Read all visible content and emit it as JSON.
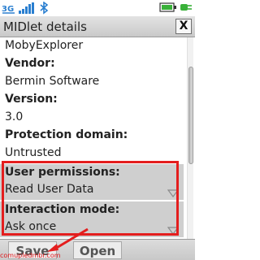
{
  "status_bar": {
    "icons": [
      "network-3g-icon",
      "signal-strength-icon",
      "bluetooth-icon",
      "battery-icon",
      "charging-plug-icon"
    ]
  },
  "window": {
    "title": "MIDlet details",
    "close_label": "X"
  },
  "details": {
    "name_value": "MobyExplorer",
    "vendor_label": "Vendor:",
    "vendor_value": "Bermin Software",
    "version_label": "Version:",
    "version_value": "3.0",
    "protection_label": "Protection domain:",
    "protection_value": "Untrusted"
  },
  "permissions": {
    "user_permissions_label": "User permissions:",
    "user_permissions_value": "Read User Data",
    "interaction_mode_label": "Interaction mode:",
    "interaction_mode_value": "Ask once"
  },
  "softkeys": {
    "left": "Save",
    "right": "Open"
  },
  "watermark": "comupledmbr.com",
  "colors": {
    "accent_red": "#e41e1e",
    "select_bg": "#cfcfcf",
    "titlebar_bg": "#d6d6d6"
  }
}
